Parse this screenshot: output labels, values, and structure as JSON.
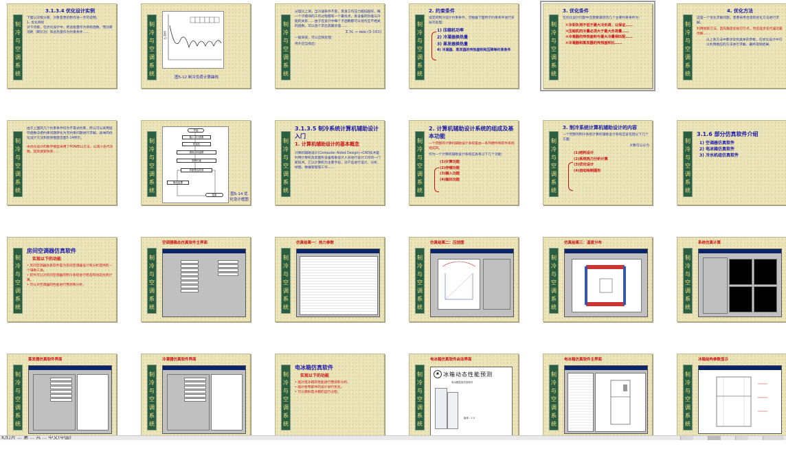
{
  "app": {
    "view": "slide-sorter",
    "status_text": "幻灯片 ... 第 ... 共 ... 中文(中国)"
  },
  "banner": "制冷与空调系统",
  "slides": [
    {
      "title": "3.1.3.4 优化设计实例",
      "body": "下面以双极分离、对象变更机制作进一步的说明。\n1. 优化目标\n对于双极，在优化设计中，把总能量作为目标函数，而功率消耗（即比功）和总热量作为约束条件……"
    },
    {
      "caption": "图5-12 制冷负荷计算曲线",
      "axis_label": "负荷 Q",
      "legend": [
        "T1",
        "T2",
        "T3",
        "T4",
        "T5",
        "T6"
      ]
    },
    {
      "body": "从理论上讲，当冷凝条件不变，蒸发工作压力越低越好，每一个子模块的工作过程都有一个最优点，各设备的热能与冷能的关系……由于在设计中每个子函数都可以视为互不相关的函数，可以逐个求出其最优值……",
      "formula": "Σ Nᵢ → min    (5-103)",
      "note": "一般来说，可以这样处理：",
      "extra": "另外应当指出："
    },
    {
      "title": "2. 约束条件",
      "body": "设定的制冷设计约束条件，可根据下图所示约束条件进行多层次处理：",
      "items": [
        "1) 压缩机功率",
        "2) 冷凝器换热量",
        "3) 蒸发器换热量",
        "4) 冷凝器、蒸发器的传热面积和压降等约束条件"
      ]
    },
    {
      "title": "3. 优化条件",
      "body": "在优化设计问题中还需要满足的几个主要约束条件为：",
      "items": [
        "①冷却负荷不低于最大冷负荷，以保证……",
        "②压缩机的冷量必须大于最大负荷量……",
        "③冷凝器的传热面积与最大冷量相匹配……",
        "④冷凝器和蒸发器的传热面积比……"
      ]
    },
    {
      "title": "4. 优化方法",
      "body": "这是一个优化求解问题，需要采用合适的优化方法进行求解。",
      "body2": "利用搜索方法，首先确定初始可行点，然后逐步迭代逼近最优解……",
      "body3": "以上各方法中都涉及到具体的参数，在优化设计中可以利用相应的方法进行求解，最终得到结果。"
    },
    {
      "body": "由于上面的几个约束条件均为不等式约束，所以可以采用惩罚函数法把约束问题转化为无约束问题进行求解。具体的优化设计方法和程序框图见图5-14所示。",
      "body2": "本优化设计的数学模型采用了POWELL方法，以减少迭代次数，提高搜索效率……"
    },
    {
      "caption": "图5-14 优化设计框图",
      "steps": [
        "开始",
        "输入设计参数",
        "初始化",
        "调用目标函数",
        "求解约束",
        "判断是否收敛",
        "输出结果",
        "结束"
      ]
    },
    {
      "title": "3.1.3.5 制冷系统计算机辅助设计入门",
      "subtitle": "1. 计算机辅助设计的基本概念",
      "body": "计算机辅助设计(Computer Aided Design)→CAD技术是利用计算机及其图形设备帮助设计人员进行设计工作的一门新技术。它以计算机为主要手段，对产品进行设计、分析、绘图、数据管理等工作……"
    },
    {
      "title": "2. 计算机辅助设计系统的组成及基本功能",
      "body": "一个完整的计算机辅助设计系统是由一系列硬件和软件系统组成的。",
      "body2": "作为一个计算机辅助设计系统应具有以下几个功能：",
      "items": [
        "(1)计算功能",
        "(2)存储功能",
        "(3)输入功能",
        "(4)输出功能"
      ]
    },
    {
      "title": "3. 制冷系统计算机辅助设计的内容",
      "body": "一个完整的制冷系统计算机辅助设计系统应该包括以下几个方面：",
      "body2": "大致可以分为",
      "items": [
        "(1)结构设计",
        "(2)系统热力分析计算",
        "(3)优化设计",
        "(4)自动绘制图形"
      ]
    },
    {
      "title": "3.1.6 部分仿真软件介绍",
      "items": [
        "1) 空调器仿真软件",
        "2) 电冰箱仿真软件",
        "3) 冷水机组仿真软件"
      ]
    },
    {
      "title": "房间空调器仿真软件",
      "heading": "实现以下的功能",
      "body": "• 房间空调器仿真软件是为房间空调器设计和分析提供的一个辅助工具。\n• 软件可以对房间空调器的制冷系统进行稳态和动态仿真计算。\n• 可以对空调器的性能进行预测和分析。"
    },
    {
      "title": "空调器稳态仿真软件主界面"
    },
    {
      "title": "仿真结果一：热力参数"
    },
    {
      "title": "仿真结果二：压焓图"
    },
    {
      "title": "仿真结果三：温度分布"
    },
    {
      "title": "系统仿真计算"
    },
    {
      "title": "蒸发器仿真软件界面"
    },
    {
      "title": "冷凝器仿真软件界面"
    },
    {
      "title": "电冰箱仿真软件",
      "heading": "实现以下的功能",
      "body": "• 能对电冰箱的性能进行预测和分析。\n• 能对各零部件的设计进行优化。\n• 可以模拟电冰箱的运行过程。"
    },
    {
      "title": "电冰箱仿真软件启动界面",
      "splash_title": "冰箱动态性能预测",
      "splash_sub": "电冰箱性能仿真软件",
      "splash_info": "版本：1.0"
    },
    {
      "title": "电冰箱仿真软件主界面"
    },
    {
      "title": "冰箱结构参数显示"
    }
  ],
  "selected_index": 4
}
